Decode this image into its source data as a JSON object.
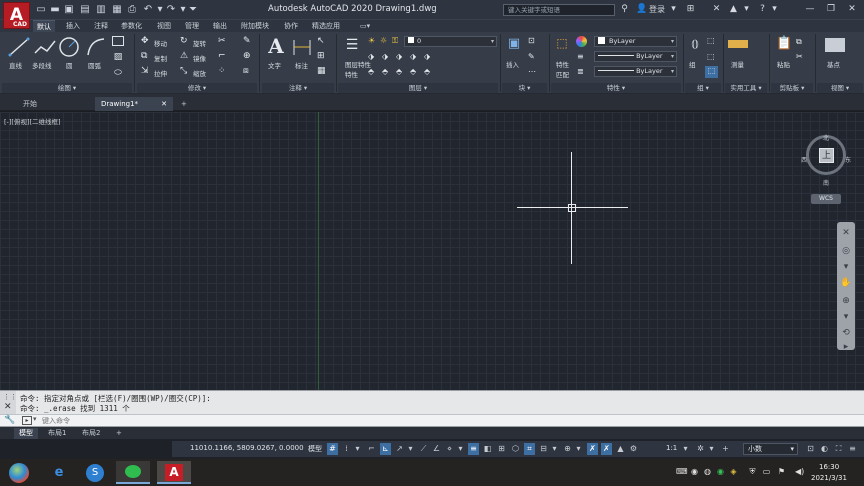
{
  "titlebar": {
    "app_logo": "A",
    "app_logo_sub": "CAD",
    "title": "Autodesk AutoCAD 2020    Drawing1.dwg",
    "search_placeholder": "键入关键字或短语",
    "login_label": "登录",
    "quick_access_icons": [
      "new-icon",
      "open-icon",
      "save-icon",
      "saveas-icon",
      "web-icon",
      "print-icon",
      "undo-icon",
      "redo-icon",
      "customize-icon"
    ],
    "title_icons": [
      "binoculars-icon",
      "user-icon",
      "cart-icon",
      "exchange-icon",
      "triangle-icon",
      "help-icon"
    ],
    "window_controls": [
      "minimize-icon",
      "restore-icon",
      "close-icon"
    ]
  },
  "menu": {
    "tabs": [
      "默认",
      "插入",
      "注释",
      "参数化",
      "视图",
      "管理",
      "输出",
      "附加模块",
      "协作",
      "精选应用"
    ],
    "active": "默认"
  },
  "ribbon": {
    "draw": {
      "title": "绘图",
      "line": "直线",
      "polyline": "多段线",
      "circle": "圆",
      "arc": "圆弧"
    },
    "modify": {
      "title": "修改",
      "move": "移动",
      "rotate": "旋转",
      "copy": "复制",
      "mirror": "镜像",
      "stretch": "拉伸",
      "scale": "缩放"
    },
    "annotation": {
      "title": "注释",
      "text": "文字",
      "dimension": "标注"
    },
    "layers": {
      "title": "图层",
      "layer_props": "图层特性",
      "layer_props_2": "特性",
      "current_layer": "0"
    },
    "block": {
      "title": "块",
      "insert": "插入"
    },
    "properties": {
      "title": "特性",
      "match": "特性",
      "match_2": "匹配",
      "color": "ByLayer",
      "linetype": "ByLayer",
      "lineweight": "ByLayer"
    },
    "groups": {
      "title": "组",
      "group": "组"
    },
    "utilities": {
      "title": "实用工具",
      "measure": "测量"
    },
    "clipboard": {
      "title": "剪贴板",
      "paste": "粘贴"
    },
    "view": {
      "title": "视图",
      "base": "基点"
    }
  },
  "file_tabs": {
    "start": "开始",
    "drawing": "Drawing1*",
    "close_icon": "close-icon",
    "add_icon": "plus-icon"
  },
  "viewport": {
    "label": "[-][俯视][二维线框]"
  },
  "viewcube": {
    "north": "北",
    "south": "南",
    "east": "东",
    "west": "西",
    "top": "上",
    "wcs": "WCS"
  },
  "command": {
    "history": [
      "命令: 指定对角点或 [栏选(F)/圈围(WP)/圈交(CP)]:",
      "命令: _.erase 找到 1311 个"
    ],
    "placeholder": "键入命令"
  },
  "layout_tabs": {
    "tabs": [
      "模型",
      "布局1",
      "布局2"
    ],
    "active": "模型",
    "add": "+"
  },
  "statusbar": {
    "coords": "11010.1166, 5809.0267, 0.0000",
    "model": "模型",
    "scale": "1:1",
    "units": "小数"
  },
  "taskbar": {
    "time": "16:30",
    "date": "2021/3/31"
  }
}
